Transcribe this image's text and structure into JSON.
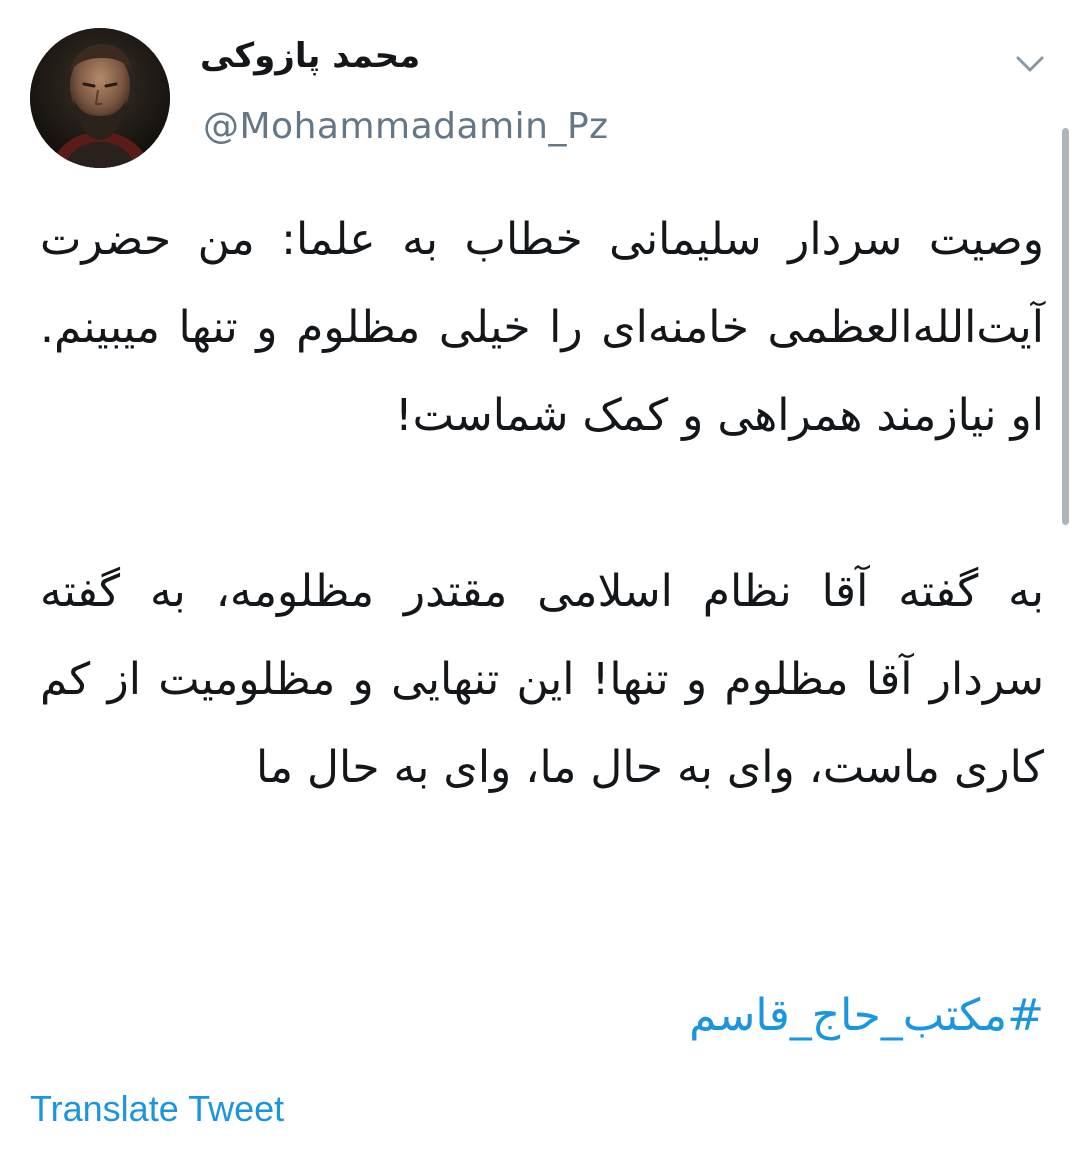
{
  "tweet": {
    "author": {
      "display_name": "محمد پازوکی",
      "handle": "@Mohammadamin_Pz"
    },
    "body": {
      "paragraph_1": "وصیت سردار سلیمانی خطاب به علما: من حضرت آیت‌الله‌العظمی خامنه‌ای را خیلی مظلوم و تنها میبینم. او نیازمند همراهی و کمک شماست!",
      "paragraph_2": "به گفته آقا نظام اسلامی مقتدر مظلومه، به گفته سردار آقا مظلوم و تنها! این تنهایی و مظلومیت از کم کاری ماست، وای به حال ما، وای به حال ما"
    },
    "hashtag": "#مکتب_حاج_قاسم",
    "translate_label": "Translate Tweet"
  },
  "icons": {
    "menu": "chevron-down-icon",
    "avatar": "avatar"
  },
  "colors": {
    "text": "#14171a",
    "secondary": "#657786",
    "link": "#1b95e0",
    "chevron": "#8899a6",
    "scrollbar": "#adb5bb"
  }
}
